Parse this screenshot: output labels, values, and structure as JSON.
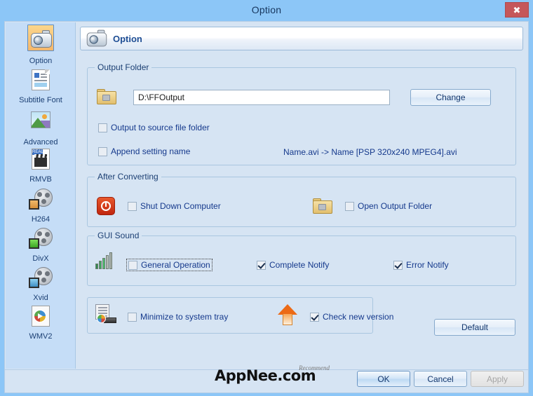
{
  "window": {
    "title": "Option",
    "close_label": "✖"
  },
  "sidebar": {
    "items": [
      {
        "label": "Option",
        "icon": "camera-icon",
        "selected": true
      },
      {
        "label": "Subtitle Font",
        "icon": "document-icon",
        "selected": false
      },
      {
        "label": "Advanced",
        "icon": "picture-icon",
        "selected": false
      },
      {
        "label": "RMVB",
        "icon": "rmvb-icon",
        "selected": false
      },
      {
        "label": "H264",
        "icon": "film-reel-icon",
        "selected": false
      },
      {
        "label": "DivX",
        "icon": "film-reel-icon",
        "selected": false
      },
      {
        "label": "Xvid",
        "icon": "film-reel-icon",
        "selected": false
      },
      {
        "label": "WMV2",
        "icon": "wmv-icon",
        "selected": false
      }
    ]
  },
  "header": {
    "title": "Option",
    "icon": "camera-icon"
  },
  "output_folder": {
    "group_title": "Output Folder",
    "folder_icon": "folder-icon",
    "path_value": "D:\\FFOutput",
    "path_placeholder": "",
    "change_label": "Change",
    "output_to_source": {
      "label": "Output to source file folder",
      "checked": false
    },
    "append_setting_name": {
      "label": "Append setting name",
      "checked": false
    },
    "name_example": "Name.avi  -> Name [PSP 320x240 MPEG4].avi"
  },
  "after_converting": {
    "group_title": "After Converting",
    "shutdown": {
      "label": "Shut Down Computer",
      "checked": false,
      "icon": "power-icon"
    },
    "open_folder": {
      "label": "Open Output Folder",
      "checked": false,
      "icon": "folder-icon"
    }
  },
  "gui_sound": {
    "group_title": "GUI Sound",
    "icon": "sound-bars-icon",
    "general_operation": {
      "label": "General Operation",
      "checked": false,
      "focused": true
    },
    "complete_notify": {
      "label": "Complete Notify",
      "checked": true
    },
    "error_notify": {
      "label": "Error Notify",
      "checked": true
    }
  },
  "misc": {
    "tray_icon": "system-tray-icon",
    "minimize_to_tray": {
      "label": "Minimize to system tray",
      "checked": false
    },
    "update_icon": "up-arrow-icon",
    "check_new_version": {
      "label": "Check new version",
      "checked": true
    },
    "default_label": "Default"
  },
  "footer": {
    "watermark_main": "AppNee.com",
    "watermark_sub": "Recommend",
    "ok_label": "OK",
    "cancel_label": "Cancel",
    "apply_label": "Apply",
    "apply_disabled": true
  },
  "colors": {
    "titlebar": "#8cc6f7",
    "panel": "#d6e4f3",
    "sidebar": "#c5ddf7",
    "accent_text": "#15398c",
    "close_button": "#c5565a",
    "selection": "#f5b76a"
  }
}
